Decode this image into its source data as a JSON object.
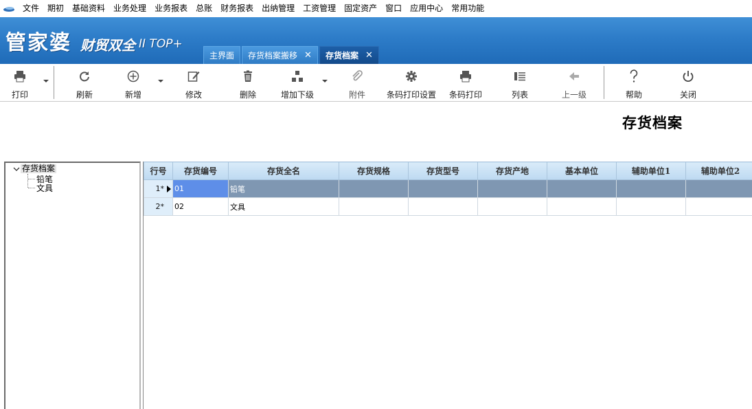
{
  "menu": {
    "items": [
      "文件",
      "期初",
      "基础资料",
      "业务处理",
      "业务报表",
      "总账",
      "财务报表",
      "出纳管理",
      "工资管理",
      "固定资产",
      "窗口",
      "应用中心",
      "常用功能"
    ]
  },
  "brand": {
    "name": "管家婆",
    "sub": "财贸双全",
    "version": "II TOP+"
  },
  "tabs": [
    {
      "label": "主界面",
      "closable": false,
      "active": false
    },
    {
      "label": "存货档案搬移",
      "closable": true,
      "active": false
    },
    {
      "label": "存货档案",
      "closable": true,
      "active": true
    }
  ],
  "tab_close_glyph": "✕",
  "toolbar": {
    "print": "打印",
    "refresh": "刷新",
    "add": "新增",
    "edit": "修改",
    "delete": "删除",
    "add_sub": "增加下级",
    "attach": "附件",
    "barcode_setup": "条码打印设置",
    "barcode_print": "条码打印",
    "list": "列表",
    "up_level": "上一级",
    "help": "帮助",
    "close": "关闭"
  },
  "page_title": "存货档案",
  "tree": {
    "root": "存货档案",
    "children": [
      "铅笔",
      "文具"
    ]
  },
  "grid": {
    "headers": [
      "行号",
      "存货编号",
      "存货全名",
      "存货规格",
      "存货型号",
      "存货产地",
      "基本单位",
      "辅助单位1",
      "辅助单位2"
    ],
    "rows": [
      {
        "num": "1*",
        "code": "01",
        "name": "铅笔",
        "spec": "",
        "model": "",
        "origin": "",
        "unit": "",
        "aux1": "",
        "aux2": ""
      },
      {
        "num": "2*",
        "code": "02",
        "name": "文具",
        "spec": "",
        "model": "",
        "origin": "",
        "unit": "",
        "aux1": "",
        "aux2": ""
      }
    ]
  },
  "colors": {
    "banner": "#2d7cc8",
    "active_tab": "#134a8a",
    "header_bg": "#bdd9f1",
    "selected_row": "#7f97b2",
    "current_cell": "#5e8ee8"
  }
}
